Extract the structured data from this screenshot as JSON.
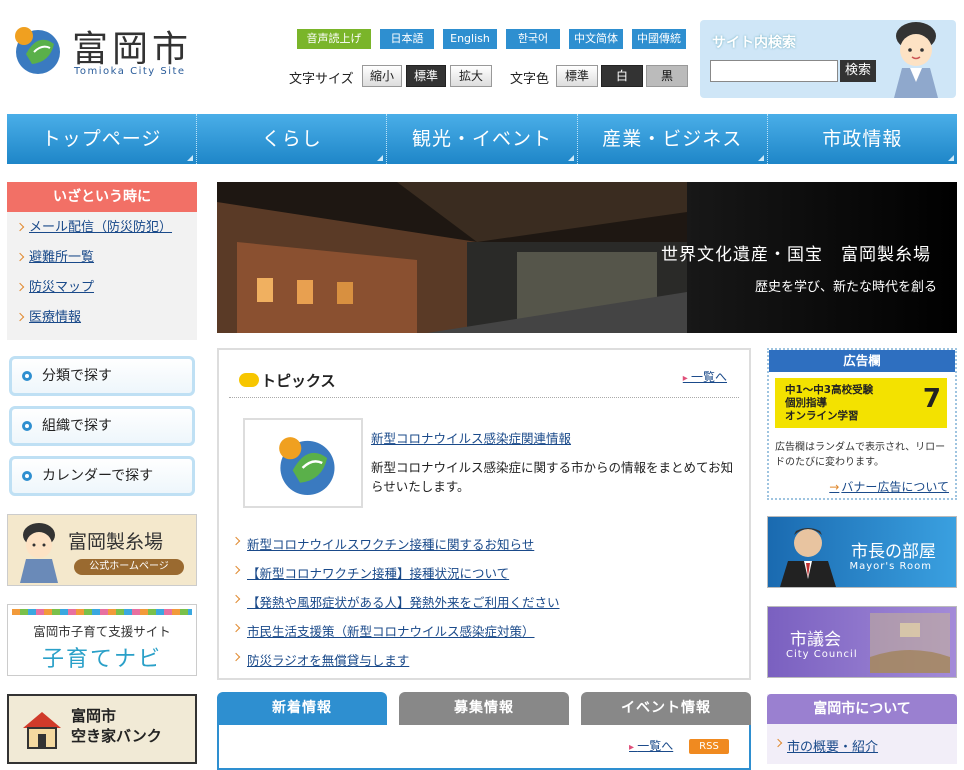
{
  "header": {
    "logo_jp": "富岡市",
    "logo_en": "Tomioka City Site",
    "languages": [
      {
        "label": "音声読上げ",
        "type": "tts"
      },
      {
        "label": "日本語"
      },
      {
        "label": "English"
      },
      {
        "label": "한국어"
      },
      {
        "label": "中文简体"
      },
      {
        "label": "中國傳統"
      }
    ],
    "font_size_label": "文字サイズ",
    "font_sizes": [
      "縮小",
      "標準",
      "拡大"
    ],
    "text_color_label": "文字色",
    "text_colors": [
      "標準",
      "白",
      "黒"
    ],
    "search_title": "サイト内検索",
    "search_placeholder": "",
    "search_button": "検索"
  },
  "nav": [
    "トップページ",
    "くらし",
    "観光・イベント",
    "産業・ビジネス",
    "市政情報"
  ],
  "emergency": {
    "title": "いざという時に",
    "items": [
      "メール配信（防災防犯）",
      "避難所一覧",
      "防災マップ",
      "医療情報"
    ]
  },
  "find": [
    "分類で探す",
    "組織で探す",
    "カレンダーで探す"
  ],
  "banners_left": {
    "silk_title": "富岡製糸場",
    "silk_sub": "公式ホームページ",
    "kosodate_top": "富岡市子育て支援サイト",
    "kosodate_main": "子育てナビ",
    "akiya_line1": "富岡市",
    "akiya_line2": "空き家バンク"
  },
  "hero": {
    "line1": "世界文化遺産・国宝　富岡製糸場",
    "line2": "歴史を学び、新たな時代を創る"
  },
  "topics": {
    "title": "トピックス",
    "more": "一覧へ",
    "featured_title": "新型コロナウイルス感染症関連情報",
    "featured_desc": "新型コロナウイルス感染症に関する市からの情報をまとめてお知らせいたします。",
    "items": [
      "新型コロナウイルスワクチン接種に関するお知らせ",
      "【新型コロナワクチン接種】接種状況について",
      "【発熱や風邪症状がある人】発熱外来をご利用ください",
      "市民生活支援策（新型コロナウイルス感染症対策）",
      "防災ラジオを無償貸与します"
    ]
  },
  "tabs": [
    "新着情報",
    "募集情報",
    "イベント情報"
  ],
  "tabpanel": {
    "more": "一覧へ",
    "rss": "RSS"
  },
  "ad": {
    "title": "広告欄",
    "img_line1": "中1～中3高校受験",
    "img_line2": "個別指導",
    "img_line3": "オンライン学習",
    "img_brand": "7",
    "desc": "広告欄はランダムで表示され、リロードのたびに変わります。",
    "link": "バナー広告について"
  },
  "banners_right": {
    "mayor_title": "市長の部屋",
    "mayor_sub": "Mayor's Room",
    "council_title": "市議会",
    "council_sub": "City Council"
  },
  "about": {
    "title": "富岡市について",
    "item": "市の概要・紹介"
  }
}
